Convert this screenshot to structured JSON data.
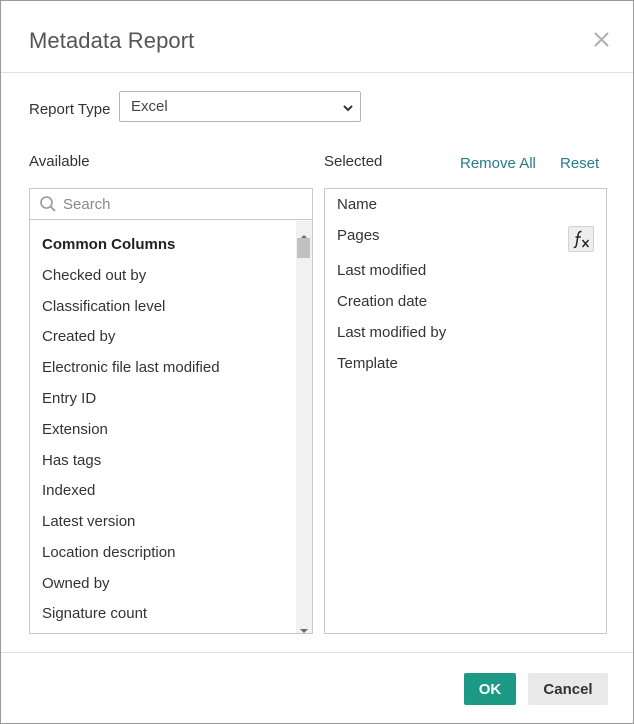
{
  "dialog": {
    "title": "Metadata Report"
  },
  "report_type": {
    "label": "Report Type",
    "selected": "Excel"
  },
  "available": {
    "label": "Available",
    "search_placeholder": "Search",
    "items": [
      {
        "label": "Common Columns",
        "is_header": true
      },
      {
        "label": "Checked out by"
      },
      {
        "label": "Classification level"
      },
      {
        "label": "Created by"
      },
      {
        "label": "Electronic file last modified"
      },
      {
        "label": "Entry ID"
      },
      {
        "label": "Extension"
      },
      {
        "label": "Has tags"
      },
      {
        "label": "Indexed"
      },
      {
        "label": "Latest version"
      },
      {
        "label": "Location description"
      },
      {
        "label": "Owned by"
      },
      {
        "label": "Signature count"
      }
    ]
  },
  "selected": {
    "label": "Selected",
    "remove_all": "Remove All",
    "reset": "Reset",
    "items": [
      {
        "label": "Name"
      },
      {
        "label": "Pages"
      },
      {
        "label": "Last modified"
      },
      {
        "label": "Creation date"
      },
      {
        "label": "Last modified by"
      },
      {
        "label": "Template"
      }
    ]
  },
  "footer": {
    "ok": "OK",
    "cancel": "Cancel"
  },
  "colors": {
    "accent": "#1c9a85",
    "link": "#2a7a8c"
  }
}
